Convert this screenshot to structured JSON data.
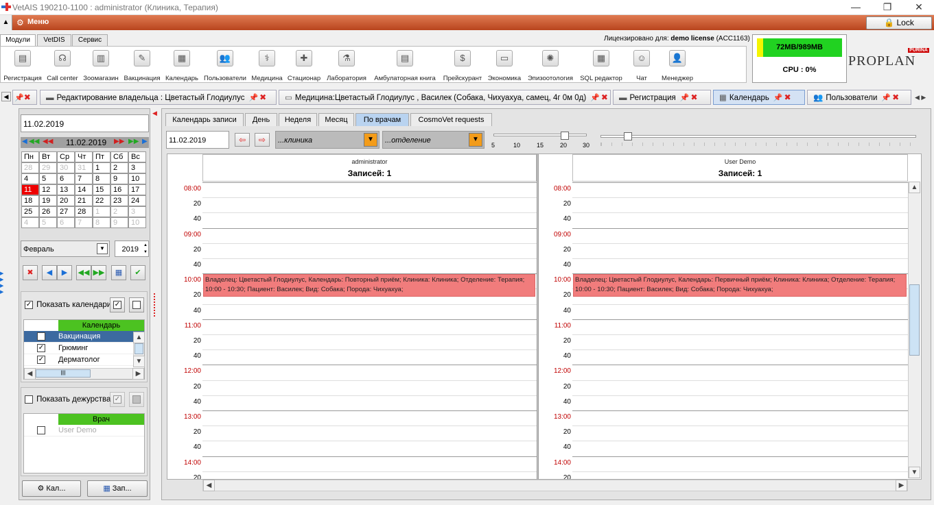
{
  "window": {
    "title": "VetAIS 190210-1100 : administrator (Клиника, Терапия)",
    "controls": [
      "—",
      "❐",
      "✕"
    ]
  },
  "menubar": {
    "menu_label": "Меню",
    "lock_label": "Lock"
  },
  "module_tabs": [
    "Модули",
    "VetDIS",
    "Сервис"
  ],
  "license": {
    "prefix": "Лицензировано для:",
    "name": "demo license",
    "code": "(ACC1163)"
  },
  "toolbar": [
    {
      "label": "Регистрация",
      "icon": "registration-icon"
    },
    {
      "label": "Call center",
      "icon": "headset-icon"
    },
    {
      "label": "Зоомагазин",
      "icon": "cash-register-icon"
    },
    {
      "label": "Вакцинация",
      "icon": "syringe-icon"
    },
    {
      "label": "Календарь",
      "icon": "calendar-icon"
    },
    {
      "label": "Пользователи",
      "icon": "users-icon"
    },
    {
      "label": "Медицина",
      "icon": "stethoscope-icon"
    },
    {
      "label": "Стационар",
      "icon": "first-aid-icon"
    },
    {
      "label": "Лаборатория",
      "icon": "flask-icon"
    },
    {
      "label": "Амбулаторная книга",
      "icon": "book-icon"
    },
    {
      "label": "Прейскурант",
      "icon": "coins-icon"
    },
    {
      "label": "Экономика",
      "icon": "money-icon"
    },
    {
      "label": "Эпизоотология",
      "icon": "bug-icon"
    },
    {
      "label": "SQL редактор",
      "icon": "database-icon"
    },
    {
      "label": "Чат",
      "icon": "chat-icon"
    },
    {
      "label": "Менеджер",
      "icon": "manager-icon"
    }
  ],
  "status": {
    "memory": "72MB/989MB",
    "memory_fraction": 0.073,
    "cpu": "CPU : 0%"
  },
  "brand": {
    "top": "PURINA",
    "main": "PROPLAN"
  },
  "doc_tabs": [
    {
      "label": "Редактирование владельца : Цветастый Глодиулус",
      "active": false
    },
    {
      "label": "Медицина:Цветастый Глодиулус , Василек (Собака, Чихуахуа, самец, 4г 0м 0д)",
      "active": false
    },
    {
      "label": "Регистрация",
      "active": false
    },
    {
      "label": "Календарь",
      "active": true
    },
    {
      "label": "Пользователи",
      "active": false
    }
  ],
  "calendar_panel": {
    "date": "11.02.2019",
    "nav_date": "11.02.2019",
    "weekdays": [
      "Пн",
      "Вт",
      "Ср",
      "Чт",
      "Пт",
      "Сб",
      "Вс"
    ],
    "weeks": [
      [
        "28",
        "29",
        "30",
        "31",
        "1",
        "2",
        "3"
      ],
      [
        "4",
        "5",
        "6",
        "7",
        "8",
        "9",
        "10"
      ],
      [
        "11",
        "12",
        "13",
        "14",
        "15",
        "16",
        "17"
      ],
      [
        "18",
        "19",
        "20",
        "21",
        "22",
        "23",
        "24"
      ],
      [
        "25",
        "26",
        "27",
        "28",
        "1",
        "2",
        "3"
      ],
      [
        "4",
        "5",
        "6",
        "7",
        "8",
        "9",
        "10"
      ]
    ],
    "selected_day": "11",
    "month": "Февраль",
    "year": "2019",
    "show_calendars_label": "Показать календари",
    "calendars_header": "Календарь",
    "calendars": [
      {
        "name": "Вакцинация",
        "checked": true,
        "selected": true
      },
      {
        "name": "Грюминг",
        "checked": true,
        "selected": false
      },
      {
        "name": "Дерматолог",
        "checked": true,
        "selected": false
      }
    ],
    "show_duty_label": "Показать дежурства",
    "doctors_header": "Врач",
    "doctors": [
      {
        "name": "User Demo",
        "checked": false
      }
    ],
    "btn_cal": "Кал...",
    "btn_zap": "Зап..."
  },
  "view_tabs": [
    "Календарь записи",
    "День",
    "Неделя",
    "Месяц",
    "По врачам",
    "CosmoVet requests"
  ],
  "active_view": "По врачам",
  "filters": {
    "date": "11.02.2019",
    "clinic_placeholder": "...клиника",
    "department_placeholder": "...отделение",
    "slider_labels": [
      "5",
      "10",
      "15",
      "20",
      "30"
    ],
    "slider_value": 20
  },
  "columns": [
    {
      "name": "administrator",
      "count": "Записей: 1"
    },
    {
      "name": "User Demo",
      "count": "Записей: 1"
    }
  ],
  "time_rows": [
    "08:00",
    "20",
    "40",
    "09:00",
    "20",
    "40",
    "10:00",
    "20",
    "40",
    "11:00",
    "20",
    "40",
    "12:00",
    "20",
    "40",
    "13:00",
    "20",
    "40",
    "14:00",
    "20"
  ],
  "appointments": [
    {
      "column": 0,
      "text": "Владелец: Цветастый Глодиулус, Календарь: Повторный приём; Клиника: Клиника; Отделение: Терапия; 10:00 - 10:30; Пациент: Василек; Вид: Собака; Порода: Чихуахуа;"
    },
    {
      "column": 1,
      "text": "Владелец: Цветастый Глодиулус, Календарь: Первичный приём; Клиника: Клиника; Отделение: Терапия; 10:00 - 10:30; Пациент: Василек; Вид: Собака; Порода: Чихуахуа;"
    }
  ]
}
